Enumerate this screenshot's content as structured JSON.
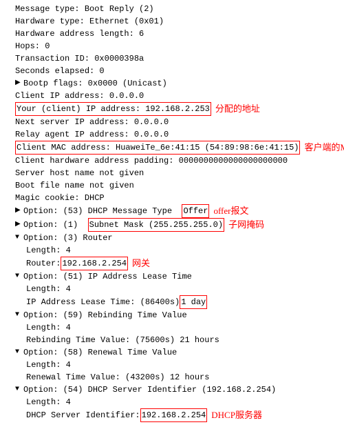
{
  "lines": [
    {
      "id": "l1",
      "indent": 1,
      "text": "Message type: Boot Reply (2)",
      "type": "plain"
    },
    {
      "id": "l2",
      "indent": 1,
      "text": "Hardware type: Ethernet (0x01)",
      "type": "plain"
    },
    {
      "id": "l3",
      "indent": 1,
      "text": "Hardware address length: 6",
      "type": "plain"
    },
    {
      "id": "l4",
      "indent": 1,
      "text": "Hops: 0",
      "type": "plain"
    },
    {
      "id": "l5",
      "indent": 1,
      "text": "Transaction ID: 0x0000398a",
      "type": "plain"
    },
    {
      "id": "l6",
      "indent": 1,
      "text": "Seconds elapsed: 0",
      "type": "plain"
    },
    {
      "id": "l7",
      "indent": 1,
      "text": "Bootp flags: 0x0000 (Unicast)",
      "type": "expandable",
      "expanded": false
    },
    {
      "id": "l8",
      "indent": 1,
      "text": "Client IP address: 0.0.0.0",
      "type": "plain"
    },
    {
      "id": "l9",
      "indent": 1,
      "text": "Your (client) IP address: 192.168.2.253",
      "type": "highlight-full",
      "highlight": "Your (client) IP address: 192.168.2.253",
      "annotation": "分配的地址"
    },
    {
      "id": "l10",
      "indent": 1,
      "text": "Next server IP address: 0.0.0.0",
      "type": "plain"
    },
    {
      "id": "l11",
      "indent": 1,
      "text": "Relay agent IP address: 0.0.0.0",
      "type": "plain"
    },
    {
      "id": "l12",
      "indent": 1,
      "text": "Client MAC address: HuaweiTe_6e:41:15 (54:89:98:6e:41:15)",
      "type": "highlight-full",
      "annotation": "客户端的MAC地址"
    },
    {
      "id": "l13",
      "indent": 1,
      "text": "Client hardware address padding: 0000000000000000000000",
      "type": "plain"
    },
    {
      "id": "l14",
      "indent": 1,
      "text": "Server host name not given",
      "type": "plain"
    },
    {
      "id": "l15",
      "indent": 1,
      "text": "Boot file name not given",
      "type": "plain"
    },
    {
      "id": "l16",
      "indent": 1,
      "text": "Magic cookie: DHCP",
      "type": "plain"
    },
    {
      "id": "l17",
      "indent": 1,
      "text": "Option: (53) DHCP Message Type",
      "highlight_part": "Offer",
      "type": "option-offer",
      "expanded": false
    },
    {
      "id": "l18",
      "indent": 1,
      "text": "Option: (1) Subnet Mask",
      "highlight_part": "(255.255.255.0)",
      "type": "option-subnet",
      "expanded": false
    },
    {
      "id": "l19",
      "indent": 1,
      "text": "Option: (3) Router",
      "type": "expandable-down"
    },
    {
      "id": "l20",
      "indent": 2,
      "text": "Length: 4",
      "type": "plain"
    },
    {
      "id": "l21",
      "indent": 2,
      "text": "Router: 192.168.2.254",
      "type": "highlight-router",
      "annotation": "网关"
    },
    {
      "id": "l22",
      "indent": 1,
      "text": "Option: (51) IP Address Lease Time",
      "type": "expandable-down"
    },
    {
      "id": "l23",
      "indent": 2,
      "text": "Length: 4",
      "type": "plain"
    },
    {
      "id": "l24",
      "indent": 2,
      "text": "IP Address Lease Time: (86400s)",
      "highlight_part": "1 day",
      "type": "option-lease"
    },
    {
      "id": "l25",
      "indent": 1,
      "text": "Option: (59) Rebinding Time Value",
      "type": "expandable-down"
    },
    {
      "id": "l26",
      "indent": 2,
      "text": "Length: 4",
      "type": "plain"
    },
    {
      "id": "l27",
      "indent": 2,
      "text": "Rebinding Time Value: (75600s) 21 hours",
      "type": "plain"
    },
    {
      "id": "l28",
      "indent": 1,
      "text": "Option: (58) Renewal Time Value",
      "type": "expandable-down"
    },
    {
      "id": "l29",
      "indent": 2,
      "text": "Length: 4",
      "type": "plain"
    },
    {
      "id": "l30",
      "indent": 2,
      "text": "Renewal Time Value: (43200s) 12 hours",
      "type": "plain"
    },
    {
      "id": "l31",
      "indent": 1,
      "text": "Option: (54) DHCP Server Identifier (192.168.2.254)",
      "type": "expandable-down"
    },
    {
      "id": "l32",
      "indent": 2,
      "text": "Length: 4",
      "type": "plain"
    },
    {
      "id": "l33",
      "indent": 2,
      "text": "DHCP Server Identifier: 192.168.2.254",
      "type": "highlight-server",
      "annotation": "DHCP服务器"
    }
  ]
}
